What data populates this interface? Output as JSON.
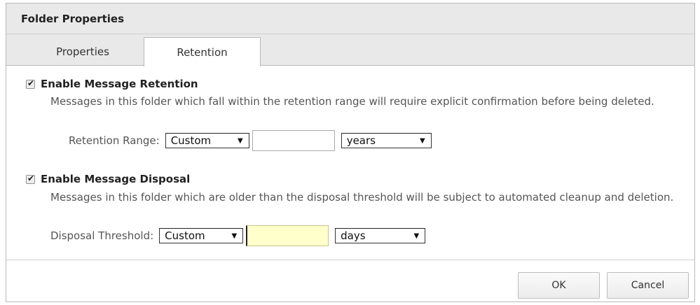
{
  "dialog": {
    "title": "Folder Properties",
    "tabs": [
      {
        "label": "Properties",
        "active": false
      },
      {
        "label": "Retention",
        "active": true
      }
    ]
  },
  "retention": {
    "checkbox_label": "Enable Message Retention",
    "checked": true,
    "description": "Messages in this folder which fall within the retention range will require explicit confirmation before being deleted.",
    "range_label": "Retention Range:",
    "range_preset": "Custom",
    "range_value": "",
    "range_unit": "years"
  },
  "disposal": {
    "checkbox_label": "Enable Message Disposal",
    "checked": true,
    "description": "Messages in this folder which are older than the disposal threshold will be subject to automated cleanup and deletion.",
    "threshold_label": "Disposal Threshold:",
    "threshold_preset": "Custom",
    "threshold_value": "",
    "threshold_unit": "days"
  },
  "buttons": {
    "ok": "OK",
    "cancel": "Cancel"
  },
  "icons": {
    "checkmark": "check-icon",
    "dropdown": "chevron-down-icon"
  },
  "colors": {
    "header_bg": "#e9e9e9",
    "focused_input_bg": "#ffffcc"
  }
}
